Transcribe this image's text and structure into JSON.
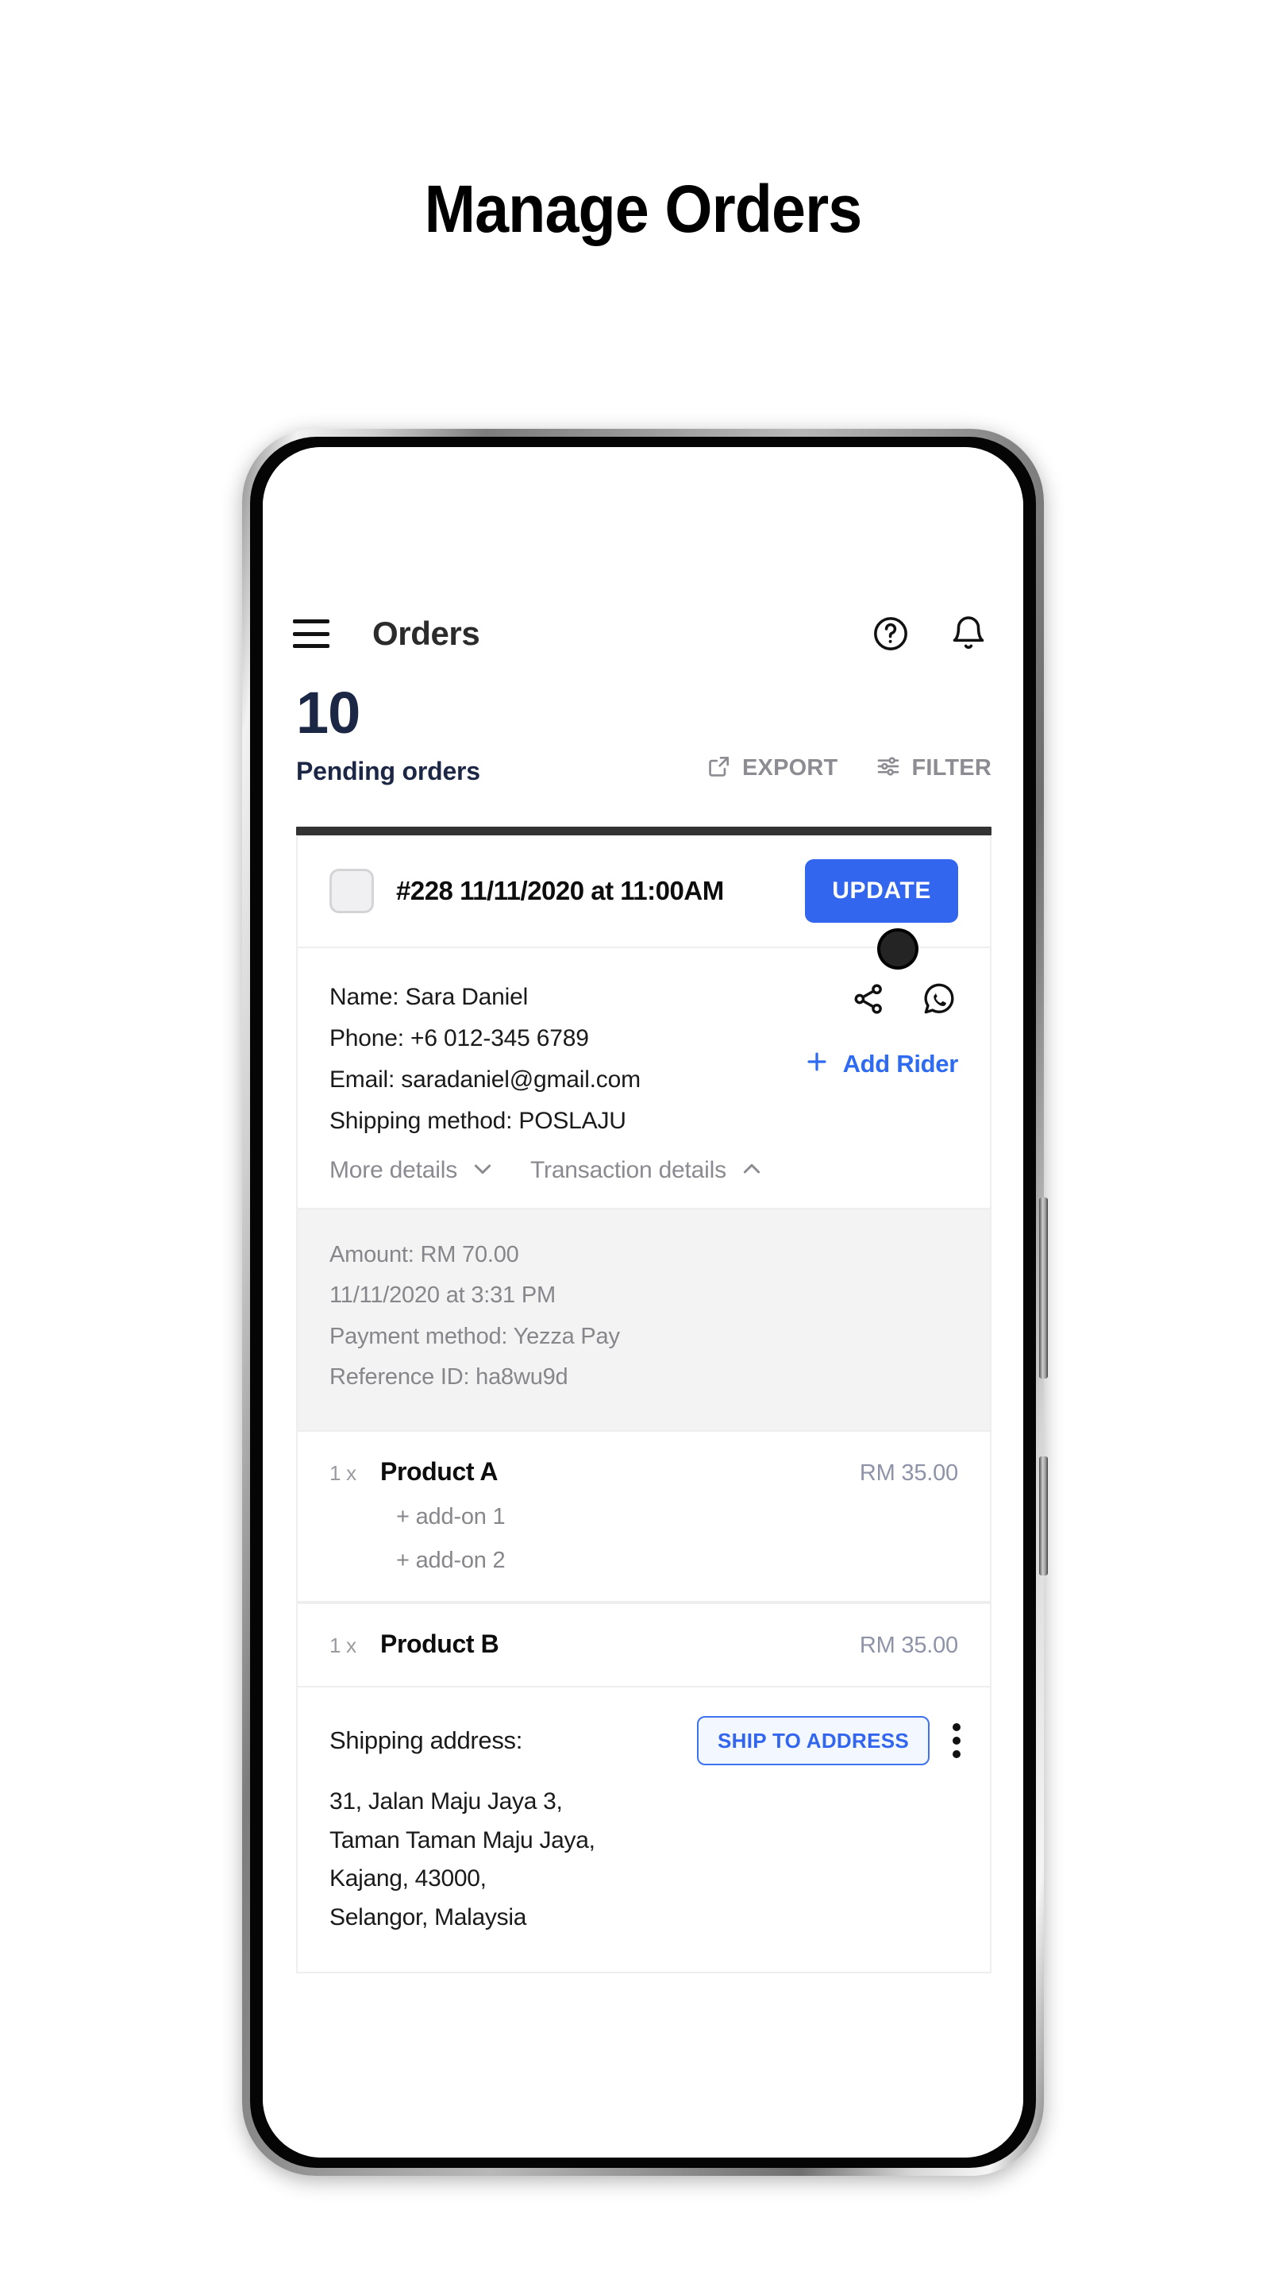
{
  "page": {
    "heading": "Manage Orders"
  },
  "app_bar": {
    "menu_icon": "hamburger-menu-icon",
    "title": "Orders",
    "help_icon": "help-circle-icon",
    "notifications_icon": "bell-icon"
  },
  "summary": {
    "count": "10",
    "label": "Pending orders",
    "export_label": "EXPORT",
    "export_icon": "external-link-icon",
    "filter_label": "FILTER",
    "filter_icon": "sliders-icon"
  },
  "order": {
    "checkbox_checked": false,
    "id_line": "#228 11/11/2020 at 11:00AM",
    "update_label": "UPDATE",
    "customer": {
      "name_line": "Name: Sara Daniel",
      "phone_line": "Phone: +6 012-345 6789",
      "email_line": "Email: saradaniel@gmail.com",
      "shipping_method_line": "Shipping method: POSLAJU"
    },
    "toggles": {
      "more_details_label": "More details",
      "more_details_icon": "chevron-down-icon",
      "transaction_details_label": "Transaction details",
      "transaction_details_icon": "chevron-up-icon"
    },
    "contact": {
      "share_icon": "share-icon",
      "whatsapp_icon": "whatsapp-icon",
      "add_rider_label": "Add Rider",
      "add_rider_icon": "plus-icon"
    },
    "transaction": {
      "amount_line": "Amount: RM 70.00",
      "datetime_line": "11/11/2020 at 3:31 PM",
      "payment_method_line": "Payment method: Yezza Pay",
      "reference_line": "Reference ID: ha8wu9d"
    },
    "products": [
      {
        "qty": "1 x",
        "name": "Product A",
        "price": "RM 35.00",
        "addons": [
          "+ add-on 1",
          "+ add-on 2"
        ]
      },
      {
        "qty": "1 x",
        "name": "Product B",
        "price": "RM 35.00",
        "addons": []
      }
    ],
    "shipping": {
      "label": "Shipping address:",
      "ship_to_address_label": "SHIP TO ADDRESS",
      "kebab_icon": "more-vertical-icon",
      "address_lines": [
        "31, Jalan Maju Jaya 3,",
        "Taman Taman Maju Jaya,",
        "Kajang, 43000,",
        "Selangor, Malaysia"
      ]
    }
  },
  "colors": {
    "primary_blue": "#3366ef",
    "navy": "#1c2746",
    "muted_gray": "#86868b",
    "price_slate": "#8e93a8"
  }
}
